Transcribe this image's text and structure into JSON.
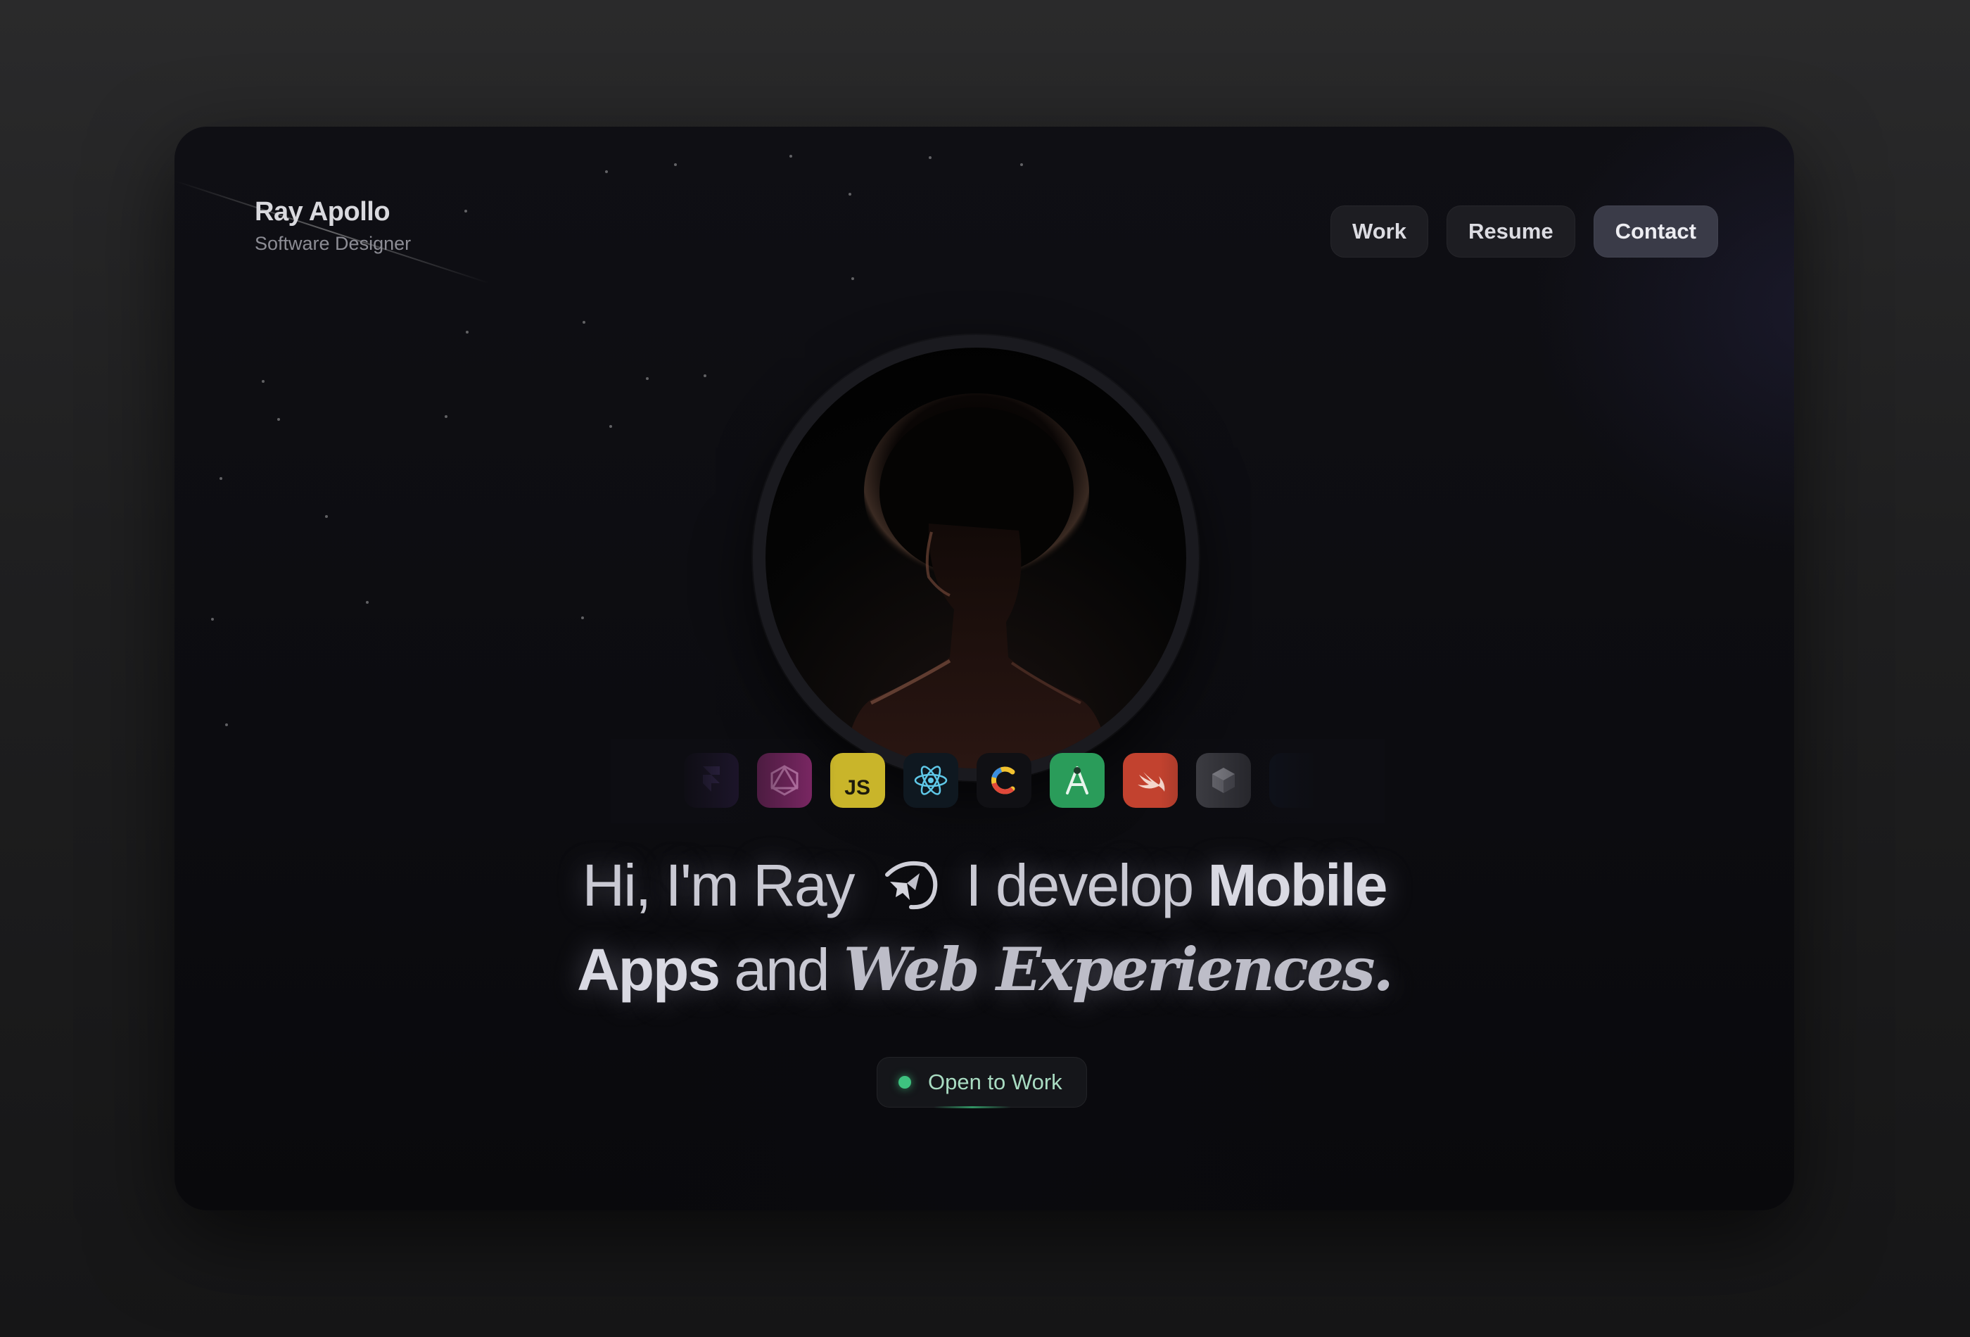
{
  "brand": {
    "name": "Ray Apollo",
    "role": "Software Designer"
  },
  "nav": {
    "work": "Work",
    "resume": "Resume",
    "contact": "Contact"
  },
  "hero": {
    "line1": {
      "greeting": "Hi, I'm Ray",
      "develop": "I develop",
      "mobile": "Mobile"
    },
    "line2": {
      "apps": "Apps",
      "and": "and",
      "web": "Web Experiences."
    }
  },
  "status": {
    "label": "Open to Work"
  },
  "tech_icons": [
    {
      "name": "framer-icon",
      "color": "#3a2456"
    },
    {
      "name": "graphql-icon",
      "color": "#8c2b70"
    },
    {
      "name": "javascript-icon",
      "color": "#c9b52a",
      "label": "JS"
    },
    {
      "name": "react-icon",
      "color": "#0f1820"
    },
    {
      "name": "c-icon",
      "color": "#101014"
    },
    {
      "name": "android-studio-icon",
      "color": "#2a9c5a"
    },
    {
      "name": "swift-icon",
      "color": "#c2422f"
    },
    {
      "name": "unity-icon",
      "color": "#4a4a50"
    }
  ],
  "colors": {
    "accent_status": "#3ec27f",
    "nav_active": "#3a3b48"
  }
}
